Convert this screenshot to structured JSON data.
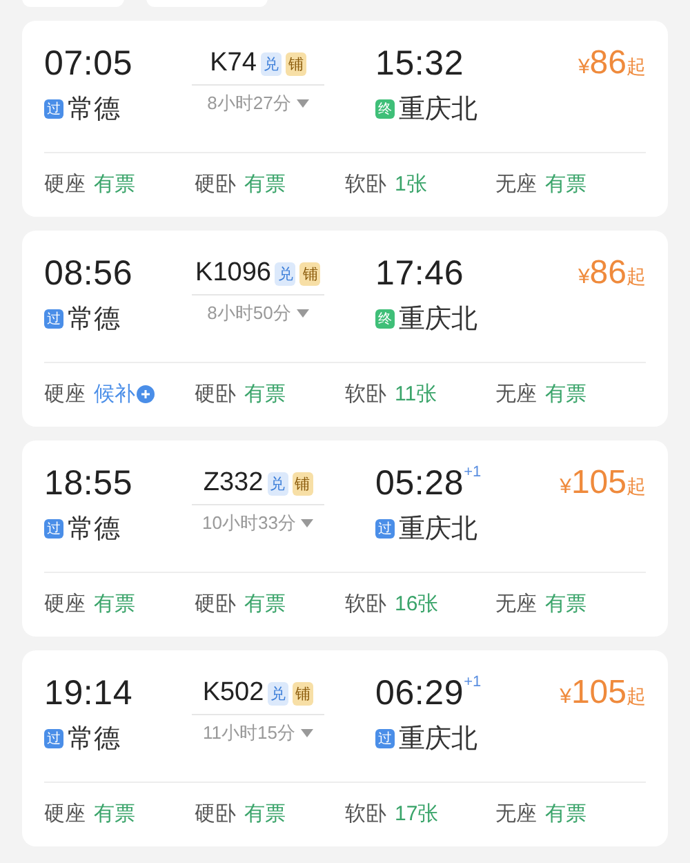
{
  "trains": [
    {
      "depart_time": "07:05",
      "depart_badge": {
        "text": "过",
        "kind": "pass"
      },
      "depart_station": "常德",
      "number": "K74",
      "tags": [
        {
          "text": "兑",
          "kind": "exchange"
        },
        {
          "text": "铺",
          "kind": "berth"
        }
      ],
      "duration": "8小时27分",
      "arrive_time": "15:32",
      "arrive_badge": {
        "text": "终",
        "kind": "terminal"
      },
      "arrive_station": "重庆北",
      "price": {
        "currency": "¥",
        "amount": "86",
        "suffix": "起"
      },
      "seats": [
        {
          "class": "硬座",
          "status": "有票",
          "kind": "available"
        },
        {
          "class": "硬卧",
          "status": "有票",
          "kind": "available"
        },
        {
          "class": "软卧",
          "status": "1张",
          "kind": "available"
        },
        {
          "class": "无座",
          "status": "有票",
          "kind": "available"
        }
      ]
    },
    {
      "depart_time": "08:56",
      "depart_badge": {
        "text": "过",
        "kind": "pass"
      },
      "depart_station": "常德",
      "number": "K1096",
      "tags": [
        {
          "text": "兑",
          "kind": "exchange"
        },
        {
          "text": "铺",
          "kind": "berth"
        }
      ],
      "duration": "8小时50分",
      "arrive_time": "17:46",
      "arrive_badge": {
        "text": "终",
        "kind": "terminal"
      },
      "arrive_station": "重庆北",
      "price": {
        "currency": "¥",
        "amount": "86",
        "suffix": "起"
      },
      "seats": [
        {
          "class": "硬座",
          "status": "候补",
          "kind": "waitlist"
        },
        {
          "class": "硬卧",
          "status": "有票",
          "kind": "available"
        },
        {
          "class": "软卧",
          "status": "11张",
          "kind": "available"
        },
        {
          "class": "无座",
          "status": "有票",
          "kind": "available"
        }
      ]
    },
    {
      "depart_time": "18:55",
      "depart_badge": {
        "text": "过",
        "kind": "pass"
      },
      "depart_station": "常德",
      "number": "Z332",
      "tags": [
        {
          "text": "兑",
          "kind": "exchange"
        },
        {
          "text": "铺",
          "kind": "berth"
        }
      ],
      "duration": "10小时33分",
      "arrive_time": "05:28",
      "next_day": "+1",
      "arrive_badge": {
        "text": "过",
        "kind": "pass"
      },
      "arrive_station": "重庆北",
      "price": {
        "currency": "¥",
        "amount": "105",
        "suffix": "起"
      },
      "seats": [
        {
          "class": "硬座",
          "status": "有票",
          "kind": "available"
        },
        {
          "class": "硬卧",
          "status": "有票",
          "kind": "available"
        },
        {
          "class": "软卧",
          "status": "16张",
          "kind": "available"
        },
        {
          "class": "无座",
          "status": "有票",
          "kind": "available"
        }
      ]
    },
    {
      "depart_time": "19:14",
      "depart_badge": {
        "text": "过",
        "kind": "pass"
      },
      "depart_station": "常德",
      "number": "K502",
      "tags": [
        {
          "text": "兑",
          "kind": "exchange"
        },
        {
          "text": "铺",
          "kind": "berth"
        }
      ],
      "duration": "11小时15分",
      "arrive_time": "06:29",
      "next_day": "+1",
      "arrive_badge": {
        "text": "过",
        "kind": "pass"
      },
      "arrive_station": "重庆北",
      "price": {
        "currency": "¥",
        "amount": "105",
        "suffix": "起"
      },
      "seats": [
        {
          "class": "硬座",
          "status": "有票",
          "kind": "available"
        },
        {
          "class": "硬卧",
          "status": "有票",
          "kind": "available"
        },
        {
          "class": "软卧",
          "status": "17张",
          "kind": "available"
        },
        {
          "class": "无座",
          "status": "有票",
          "kind": "available"
        }
      ]
    }
  ]
}
